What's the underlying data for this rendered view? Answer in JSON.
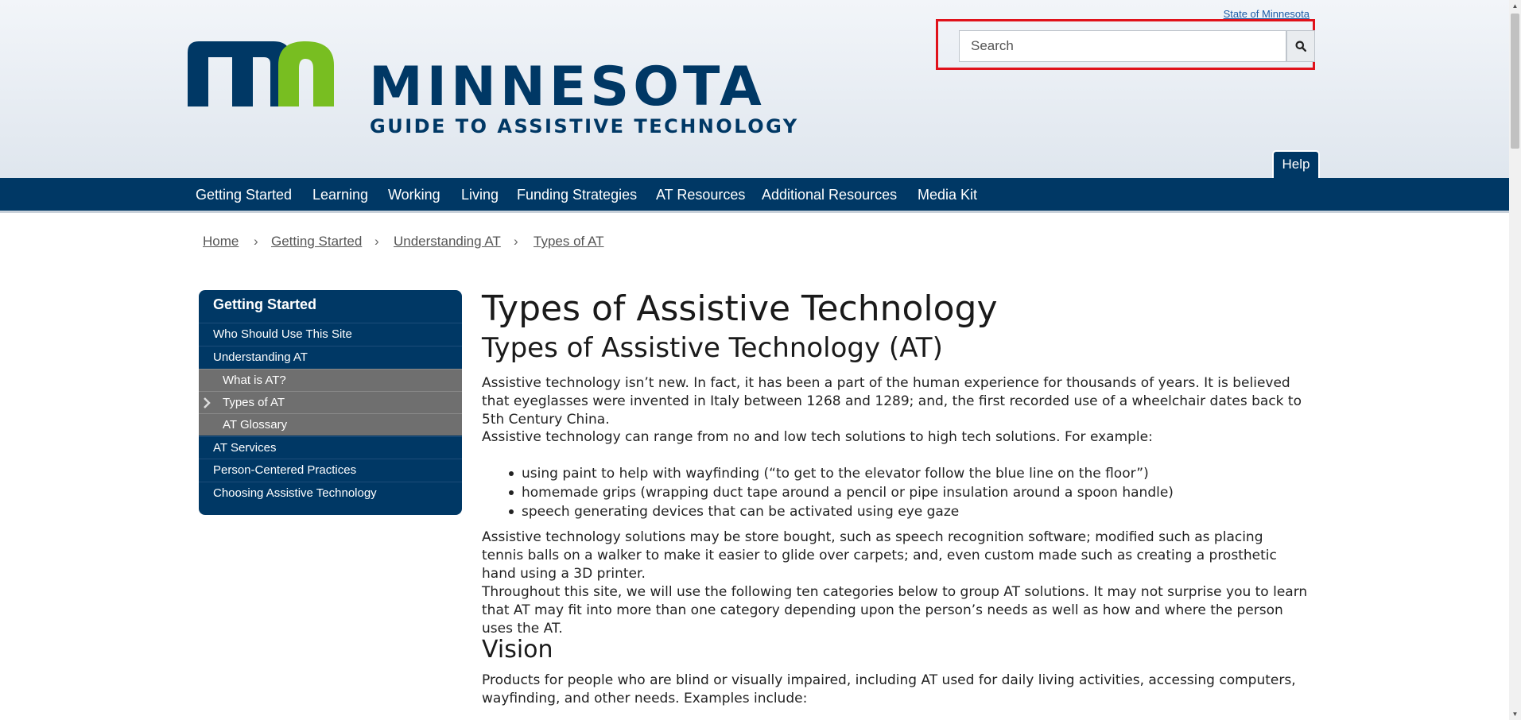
{
  "header": {
    "state_link": "State of Minnesota",
    "logo_word": "MINNESOTA",
    "logo_subtitle": "GUIDE TO ASSISTIVE TECHNOLOGY",
    "search_placeholder": "Search",
    "help_label": "Help"
  },
  "nav": {
    "items": [
      "Getting Started",
      "Learning",
      "Working",
      "Living",
      "Funding Strategies",
      "AT Resources",
      "Additional Resources",
      "Media Kit"
    ]
  },
  "breadcrumb": {
    "items": [
      "Home",
      "Getting Started",
      "Understanding AT",
      "Types of AT"
    ],
    "separator": "›"
  },
  "sidebar": {
    "title": "Getting Started",
    "items": [
      "Who Should Use This Site",
      "Understanding AT",
      "What is AT?",
      "Types of AT",
      "AT Glossary",
      "AT Services",
      "Person-Centered Practices",
      "Choosing Assistive Technology"
    ]
  },
  "content": {
    "title": "Types of Assistive Technology",
    "subtitle": "Types of Assistive Technology (AT)",
    "p1": "Assistive technology isn’t new. In fact, it has been a part of the human experience for thousands of years. It is believed that eyeglasses were invented in Italy between 1268 and 1289; and, the first recorded use of a wheelchair dates back to 5th Century China.",
    "p2": "Assistive technology can range from no and low tech solutions to high tech solutions. For example:",
    "bullets": [
      "using paint to help with wayfinding (“to get to the elevator follow the blue line on the floor”)",
      "homemade grips (wrapping duct tape around a pencil or pipe insulation around a spoon handle)",
      "speech generating devices that can be activated using eye gaze"
    ],
    "p3": "Assistive technology solutions may be store bought, such as speech recognition software; modified such as placing tennis balls on a walker to make it easier to glide over carpets; and, even custom made such as creating a prosthetic hand using a 3D printer.",
    "p4": "Throughout this site, we will use the following ten categories below to group AT solutions. It may not surprise you to learn that AT may fit into more than one category depending upon the person’s needs as well as how and where the person uses the AT.",
    "section_heading": "Vision",
    "p5": "Products for people who are blind or visually impaired, including AT used for daily living activities, accessing computers, wayfinding, and other needs. Examples include:"
  },
  "colors": {
    "brand_navy": "#003865",
    "brand_green": "#78be21",
    "highlight_red": "#e0121b"
  }
}
